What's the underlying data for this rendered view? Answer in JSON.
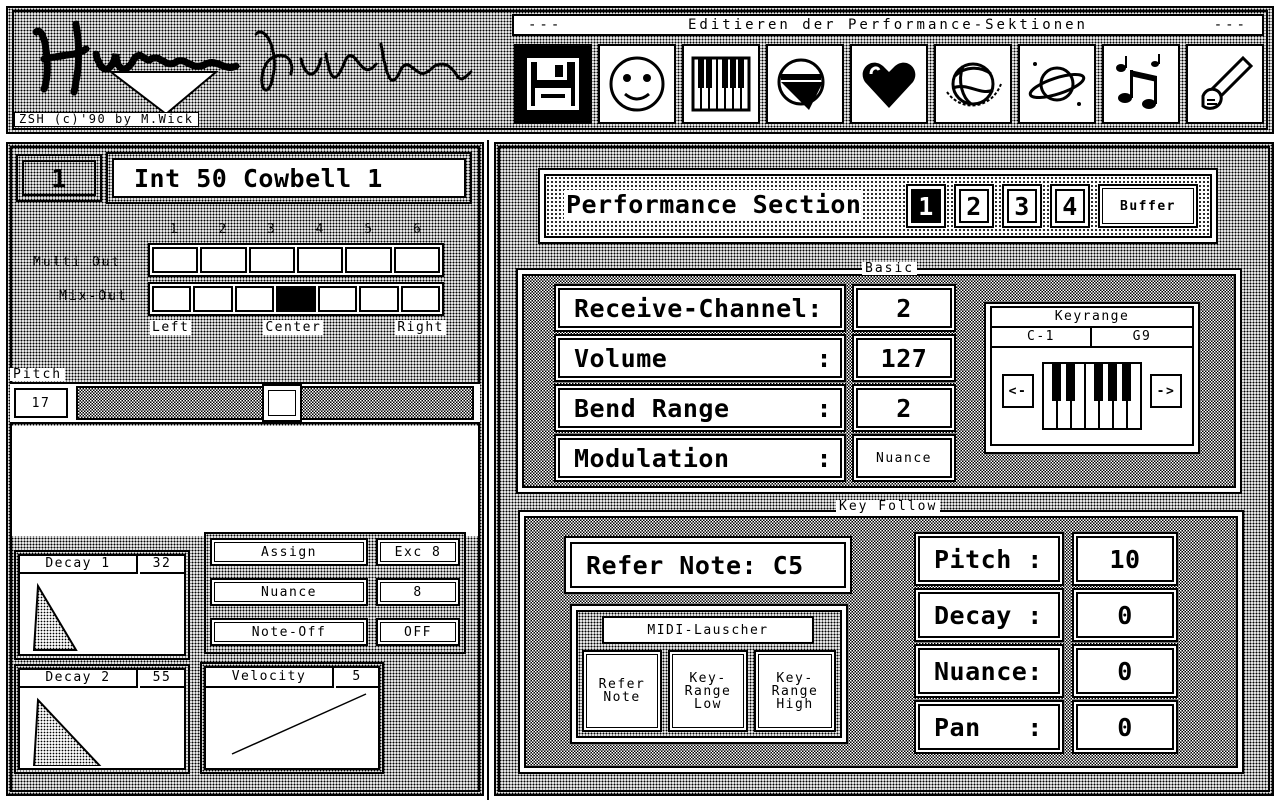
{
  "header": {
    "title": "Editieren der Performance-Sektionen",
    "title_left_marker": "---",
    "title_right_marker": "---",
    "logo_text": "Hunter Guide",
    "copyright": "ZSH (c)'90 by M.Wick",
    "toolbar_icons": [
      "disk-icon",
      "face-icon",
      "piano-keys-icon",
      "mixer-funnel-icon",
      "heart-icon",
      "globe-swirl-icon",
      "planet-icon",
      "music-notes-icon",
      "hand-pen-icon"
    ]
  },
  "left": {
    "instrument_number": "1",
    "instrument_name": "Int 50 Cowbell 1",
    "out_numbers": [
      "1",
      "2",
      "3",
      "4",
      "5",
      "6"
    ],
    "multi_out_label": "Multi Out",
    "mix_out_label": "Mix-Out",
    "mix_out_selected_index": 3,
    "pan_labels": {
      "left": "Left",
      "center": "Center",
      "right": "Right"
    },
    "pitch_label": "Pitch",
    "pitch_value": "17",
    "decay1": {
      "label": "Decay 1",
      "value": "32"
    },
    "decay2": {
      "label": "Decay 2",
      "value": "55"
    },
    "velocity": {
      "label": "Velocity",
      "value": "5"
    },
    "buttons": [
      {
        "label": "Assign",
        "value": "Exc 8"
      },
      {
        "label": "Nuance",
        "value": "8"
      },
      {
        "label": "Note-Off",
        "value": "OFF"
      }
    ]
  },
  "right": {
    "performance_title": "Performance Section",
    "sections": [
      "1",
      "2",
      "3",
      "4"
    ],
    "selected_section": "1",
    "buffer_label": "Buffer",
    "basic_label": "Basic",
    "basic": [
      {
        "label": "Receive-Channel:",
        "value": "2"
      },
      {
        "label": "Volume",
        "value": "127"
      },
      {
        "label": "Bend Range",
        "value": "2"
      },
      {
        "label": "Modulation",
        "value": "Nuance"
      }
    ],
    "colon": ":",
    "keyrange": {
      "title": "Keyrange",
      "low": "C-1",
      "high": "G9",
      "left_arrow": "<-",
      "right_arrow": "->"
    },
    "key_follow_label": "Key Follow",
    "refer_note": "Refer Note: C5",
    "midi_lauscher": {
      "title": "MIDI-Lauscher",
      "buttons": [
        "Refer Note",
        "Key-Range Low",
        "Key-Range High"
      ]
    },
    "key_follow": [
      {
        "label": "Pitch :",
        "value": "10"
      },
      {
        "label": "Decay :",
        "value": "0"
      },
      {
        "label": "Nuance:",
        "value": "0"
      },
      {
        "label": "Pan   :",
        "value": "0"
      }
    ]
  },
  "colors": {
    "foreground": "#000000",
    "background": "#ffffff"
  }
}
